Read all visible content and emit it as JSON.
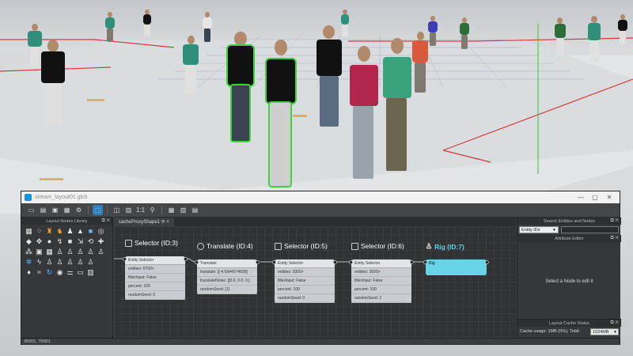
{
  "window": {
    "title": "stream_layout01.glch",
    "controls": [
      "—",
      "▢",
      "✕"
    ]
  },
  "toolbar": {
    "zoom_label": "1:1",
    "icons": [
      "new-icon",
      "open-icon",
      "save-icon",
      "save-as-icon",
      "settings-icon",
      "select-icon",
      "frame-icon",
      "fit-icon",
      "zoom-icon",
      "search-icon",
      "layout-icon",
      "panels-icon",
      "grid-icon"
    ]
  },
  "left_panel": {
    "title": "Layout Nodes Library",
    "buttons": "⧉ ✕"
  },
  "graph": {
    "tab": "cacheProxyShape1 ⟳ ×",
    "nodes": [
      {
        "title": "Selector (ID:3)",
        "sub": "Entity Selector",
        "rows": [
          "entities: 6?00>",
          "filterInput: False",
          "percent: 100",
          "randomSeed: 0"
        ]
      },
      {
        "title": "Translate (ID:4)",
        "sub": "Translate",
        "rows": [
          "translate: [[-4.69445?4699]",
          "translateNoise: [[0.0, 0.0, 0.]",
          "randomSeed: [1]"
        ]
      },
      {
        "title": "Selector (ID:5)",
        "sub": "Entity Selector",
        "rows": [
          "entities: 2000>",
          "filterInput: False",
          "percent: 100",
          "randomSeed: 0"
        ]
      },
      {
        "title": "Selector (ID:6)",
        "sub": "Entity Selector",
        "rows": [
          "entities: 3500>",
          "filterInput: False",
          "percent: 100",
          "randomSeed: 2"
        ]
      },
      {
        "title": "Rig (ID:7)",
        "sub": "Rig",
        "rows": []
      }
    ]
  },
  "right_panel": {
    "search_title": "Search Entities and Nodes",
    "search_mode": "Entity IDs",
    "attribute_title": "Attribute Editor",
    "select_msg": "Select a Node to edit it",
    "cache_title": "Layout Cache Status",
    "cache_usage": "Cache usage: 1MB (0%), Total:",
    "cache_total": "1024MB",
    "buttons": "⧉ ✕"
  },
  "status": {
    "text": "35001, 70001"
  },
  "colors": {
    "selection_glow": "#3fd23a",
    "rig_node": "#4fc9de",
    "active_tool": "#2f7fc0"
  }
}
